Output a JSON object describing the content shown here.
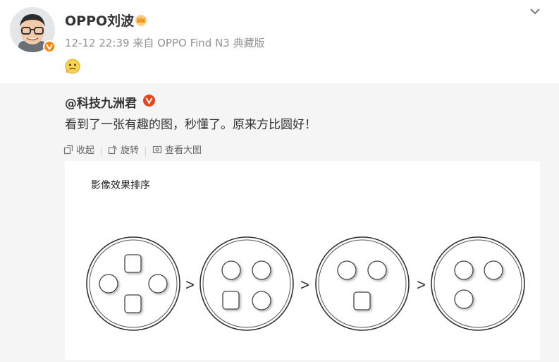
{
  "post": {
    "author": "OPPO刘波",
    "meta": "12-12 22:39 来自 OPPO Find N3 典藏版",
    "icons": {
      "avatar": "memoji-avatar",
      "verified": "verified-badge-icon",
      "crown": "vip-crown-icon",
      "emoji": "thinking-face-emoji",
      "menu": "chevron-down-icon"
    },
    "colors": {
      "verified": "#ff8200",
      "meta": "#939393"
    }
  },
  "repost": {
    "author": "@科技九洲君",
    "text": "看到了一张有趣的图，秒懂了。原来方比圆好！",
    "toolbar": {
      "collapse": "收起",
      "rotate": "旋转",
      "view_large": "查看大图"
    },
    "colors": {
      "background": "#f5f5f5",
      "badge": "#e8451e"
    }
  },
  "image": {
    "title": "影像效果排序",
    "separator": ">",
    "modules": [
      {
        "rank": 1,
        "lenses": [
          "square",
          "circle",
          "circle",
          "square"
        ]
      },
      {
        "rank": 2,
        "lenses": [
          "circle",
          "circle",
          "square",
          "circle"
        ]
      },
      {
        "rank": 3,
        "lenses": [
          "circle",
          "circle",
          "square"
        ]
      },
      {
        "rank": 4,
        "lenses": [
          "circle",
          "circle",
          "circle"
        ]
      }
    ]
  }
}
